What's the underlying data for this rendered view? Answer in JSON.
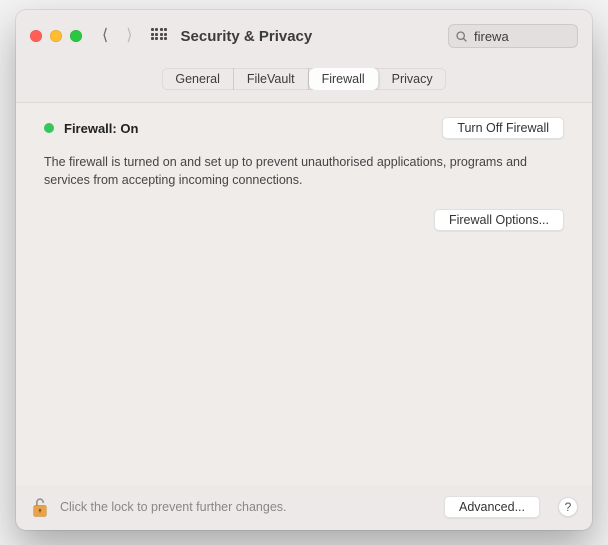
{
  "window": {
    "title": "Security & Privacy"
  },
  "search": {
    "value": "firewa"
  },
  "tabs": [
    {
      "label": "General",
      "active": false
    },
    {
      "label": "FileVault",
      "active": false
    },
    {
      "label": "Firewall",
      "active": true
    },
    {
      "label": "Privacy",
      "active": false
    }
  ],
  "firewall": {
    "status_label": "Firewall: On",
    "status_color": "#34c759",
    "toggle_button": "Turn Off Firewall",
    "description": "The firewall is turned on and set up to prevent unauthorised applications, programs and services from accepting incoming connections.",
    "options_button": "Firewall Options..."
  },
  "footer": {
    "lock_text": "Click the lock to prevent further changes.",
    "advanced_button": "Advanced...",
    "help_label": "?"
  }
}
